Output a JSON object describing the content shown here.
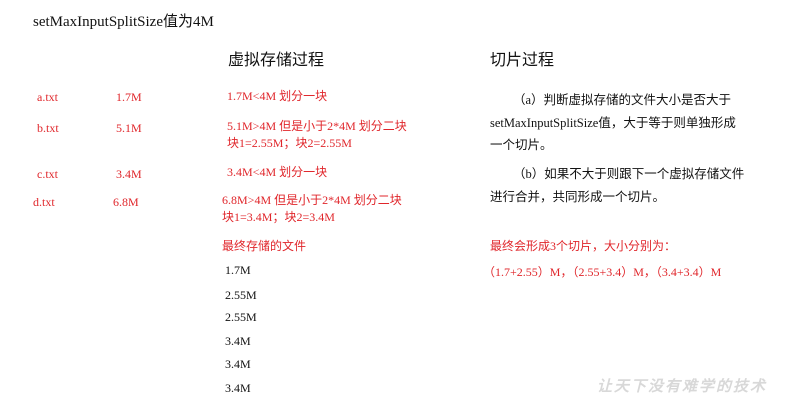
{
  "title": "setMaxInputSplitSize值为4M",
  "left_heading": "虚拟存储过程",
  "right_heading": "切片过程",
  "files": [
    {
      "name": "a.txt",
      "size": "1.7M",
      "result": "1.7M<4M 划分一块"
    },
    {
      "name": "b.txt",
      "size": "5.1M",
      "result": "5.1M>4M 但是小于2*4M  划分二块",
      "result2": "块1=2.55M；块2=2.55M"
    },
    {
      "name": "c.txt",
      "size": "3.4M",
      "result": "3.4M<4M 划分一块"
    },
    {
      "name": "d.txt",
      "size": "6.8M",
      "result": "6.8M>4M 但是小于2*4M  划分二块",
      "result2": "块1=3.4M；块2=3.4M"
    }
  ],
  "final_files_label": "最终存储的文件",
  "final_files": [
    "1.7M",
    "2.55M",
    "2.55M",
    "3.4M",
    "3.4M",
    "3.4M"
  ],
  "rule_a": {
    "line1": "（a）判断虚拟存储的文件大小是否大于",
    "line2": "setMaxInputSplitSize值，大于等于则单独形成",
    "line3": "一个切片。"
  },
  "rule_b": {
    "line1": "（b）如果不大于则跟下一个虚拟存储文件",
    "line2": "进行合并，共同形成一个切片。"
  },
  "summary": {
    "line1": "最终会形成3个切片，大小分别为：",
    "line2": "（1.7+2.55）M，（2.55+3.4）M，（3.4+3.4）M"
  },
  "watermark": "让天下没有难学的技术",
  "colors": {
    "accent": "#e0262b",
    "text": "#111111",
    "watermark": "#d8d8d8"
  }
}
